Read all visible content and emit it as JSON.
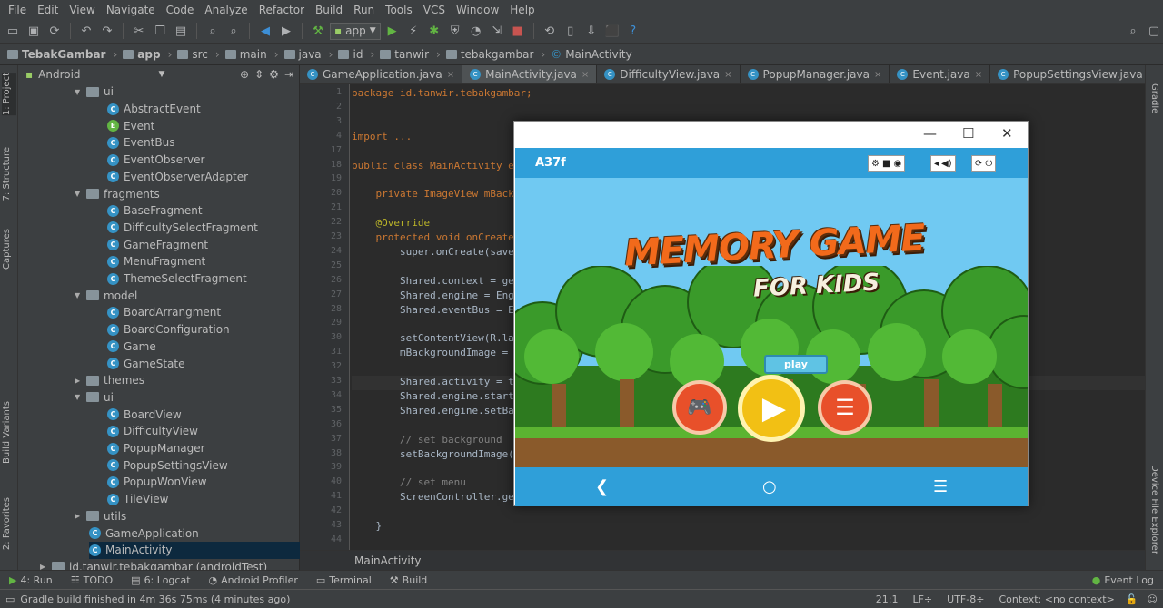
{
  "menu": [
    "File",
    "Edit",
    "View",
    "Navigate",
    "Code",
    "Analyze",
    "Refactor",
    "Build",
    "Run",
    "Tools",
    "VCS",
    "Window",
    "Help"
  ],
  "toolbar": {
    "run_config": "app"
  },
  "breadcrumbs": [
    "TebakGambar",
    "app",
    "src",
    "main",
    "java",
    "id",
    "tanwir",
    "tebakgambar",
    "MainActivity"
  ],
  "project": {
    "view": "Android",
    "items": [
      {
        "label": "ui",
        "kind": "folder"
      },
      {
        "label": "AbstractEvent",
        "kind": "class"
      },
      {
        "label": "Event",
        "kind": "event"
      },
      {
        "label": "EventBus",
        "kind": "class"
      },
      {
        "label": "EventObserver",
        "kind": "class"
      },
      {
        "label": "EventObserverAdapter",
        "kind": "class"
      },
      {
        "label": "fragments",
        "kind": "folder"
      },
      {
        "label": "BaseFragment",
        "kind": "class"
      },
      {
        "label": "DifficultySelectFragment",
        "kind": "class"
      },
      {
        "label": "GameFragment",
        "kind": "class"
      },
      {
        "label": "MenuFragment",
        "kind": "class"
      },
      {
        "label": "ThemeSelectFragment",
        "kind": "class"
      },
      {
        "label": "model",
        "kind": "folder"
      },
      {
        "label": "BoardArrangment",
        "kind": "class"
      },
      {
        "label": "BoardConfiguration",
        "kind": "class"
      },
      {
        "label": "Game",
        "kind": "class"
      },
      {
        "label": "GameState",
        "kind": "class"
      },
      {
        "label": "themes",
        "kind": "folder"
      },
      {
        "label": "ui",
        "kind": "folder"
      },
      {
        "label": "BoardView",
        "kind": "class"
      },
      {
        "label": "DifficultyView",
        "kind": "class"
      },
      {
        "label": "PopupManager",
        "kind": "class"
      },
      {
        "label": "PopupSettingsView",
        "kind": "class"
      },
      {
        "label": "PopupWonView",
        "kind": "class"
      },
      {
        "label": "TileView",
        "kind": "class"
      },
      {
        "label": "utils",
        "kind": "folder"
      },
      {
        "label": "GameApplication",
        "kind": "class"
      },
      {
        "label": "MainActivity",
        "kind": "class"
      },
      {
        "label": "id.tanwir.tebakgambar (androidTest)",
        "kind": "folder"
      }
    ]
  },
  "tabs": [
    "GameApplication.java",
    "MainActivity.java",
    "DifficultyView.java",
    "PopupManager.java",
    "Event.java",
    "PopupSettingsView.java"
  ],
  "active_tab": "MainActivity.java",
  "code_lines": [
    {
      "n": "1",
      "t": "package id.tanwir.tebakgambar;"
    },
    {
      "n": "2",
      "t": ""
    },
    {
      "n": "3",
      "t": ""
    },
    {
      "n": "4",
      "t": "import ..."
    },
    {
      "n": "17",
      "t": ""
    },
    {
      "n": "18",
      "t": "public class MainActivity e"
    },
    {
      "n": "19",
      "t": ""
    },
    {
      "n": "20",
      "t": "    private ImageView mBack"
    },
    {
      "n": "21",
      "t": ""
    },
    {
      "n": "22",
      "t": "    @Override"
    },
    {
      "n": "23",
      "t": "    protected void onCreate"
    },
    {
      "n": "24",
      "t": "        super.onCreate(save"
    },
    {
      "n": "25",
      "t": ""
    },
    {
      "n": "26",
      "t": "        Shared.context = ge"
    },
    {
      "n": "27",
      "t": "        Shared.engine = Eng"
    },
    {
      "n": "28",
      "t": "        Shared.eventBus = E"
    },
    {
      "n": "29",
      "t": ""
    },
    {
      "n": "30",
      "t": "        setContentView(R.la"
    },
    {
      "n": "31",
      "t": "        mBackgroundImage = "
    },
    {
      "n": "32",
      "t": ""
    },
    {
      "n": "33",
      "t": "        Shared.activity = t"
    },
    {
      "n": "34",
      "t": "        Shared.engine.start"
    },
    {
      "n": "35",
      "t": "        Shared.engine.setBa"
    },
    {
      "n": "36",
      "t": ""
    },
    {
      "n": "37",
      "t": "        // set background"
    },
    {
      "n": "38",
      "t": "        setBackgroundImage("
    },
    {
      "n": "39",
      "t": ""
    },
    {
      "n": "40",
      "t": "        // set menu"
    },
    {
      "n": "41",
      "t": "        ScreenController.ge"
    },
    {
      "n": "42",
      "t": ""
    },
    {
      "n": "43",
      "t": "    }"
    },
    {
      "n": "44",
      "t": ""
    }
  ],
  "editor_status": "MainActivity",
  "emulator": {
    "device": "A37f",
    "logo_line1": "MEMORY GAME",
    "logo_line2": "FOR KIDS",
    "play_tag": "play",
    "window_controls": [
      "—",
      "☐",
      "✕"
    ]
  },
  "bottom_tools": [
    {
      "label": "4: Run",
      "icon": "run-icon"
    },
    {
      "label": "TODO",
      "icon": "todo-icon"
    },
    {
      "label": "6: Logcat",
      "icon": "logcat-icon"
    },
    {
      "label": "Android Profiler",
      "icon": "profiler-icon"
    },
    {
      "label": "Terminal",
      "icon": "terminal-icon"
    },
    {
      "label": "Build",
      "icon": "build-icon"
    }
  ],
  "event_log": "Event Log",
  "status": {
    "message": "Gradle build finished in 4m 36s 75ms (4 minutes ago)",
    "position": "21:1",
    "line_sep": "LF÷",
    "encoding": "UTF-8÷",
    "context": "Context: <no context>"
  },
  "side_tabs": {
    "left": [
      "1: Project",
      "7: Structure",
      "Captures",
      "Build Variants",
      "2: Favorites"
    ],
    "right": [
      "Gradle",
      "Device File Explorer"
    ]
  }
}
